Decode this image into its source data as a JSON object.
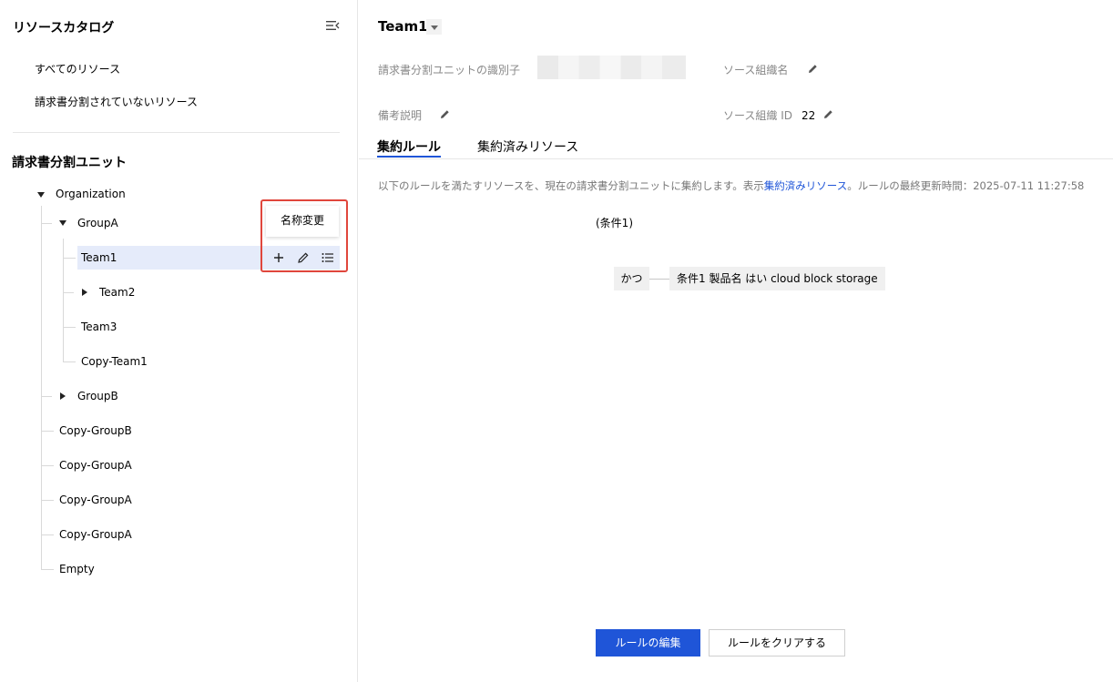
{
  "sidebar": {
    "title": "リソースカタログ",
    "links": [
      "すべてのリソース",
      "請求書分割されていないリソース"
    ],
    "units_title": "請求書分割ユニット",
    "tree": {
      "organization": "Organization",
      "groupA": "GroupA",
      "team1": "Team1",
      "team2": "Team2",
      "team3": "Team3",
      "copyTeam1": "Copy-Team1",
      "groupB": "GroupB",
      "copyGroupB": "Copy-GroupB",
      "copyGroupA1": "Copy-GroupA",
      "copyGroupA2": "Copy-GroupA",
      "copyGroupA3": "Copy-GroupA",
      "empty": "Empty"
    },
    "tooltip": "名称変更"
  },
  "header": {
    "title": "Team1"
  },
  "fields": {
    "identifier_label": "請求書分割ユニットの識別子",
    "source_org_name_label": "ソース組織名",
    "remarks_label": "備考説明",
    "source_org_id_label": "ソース組織 ID",
    "source_org_id_value": "22"
  },
  "tabs": [
    "集約ルール",
    "集約済みリソース"
  ],
  "rule": {
    "desc_prefix": "以下のルールを満たすリソースを、現在の請求書分割ユニットに集約します。表示",
    "desc_link": "集約済みリソース",
    "desc_suffix": "。ルールの最終更新時間：2025-07-11 11:27:58",
    "condition_title": "(条件1)",
    "and_label": "かつ",
    "condition_text": "条件1  製品名  はい  cloud block storage"
  },
  "buttons": {
    "edit": "ルールの編集",
    "clear": "ルールをクリアする"
  },
  "colors": {
    "accent": "#1f55d8",
    "selected_row": "#e5ebfa",
    "highlight_border": "#e0463c"
  }
}
